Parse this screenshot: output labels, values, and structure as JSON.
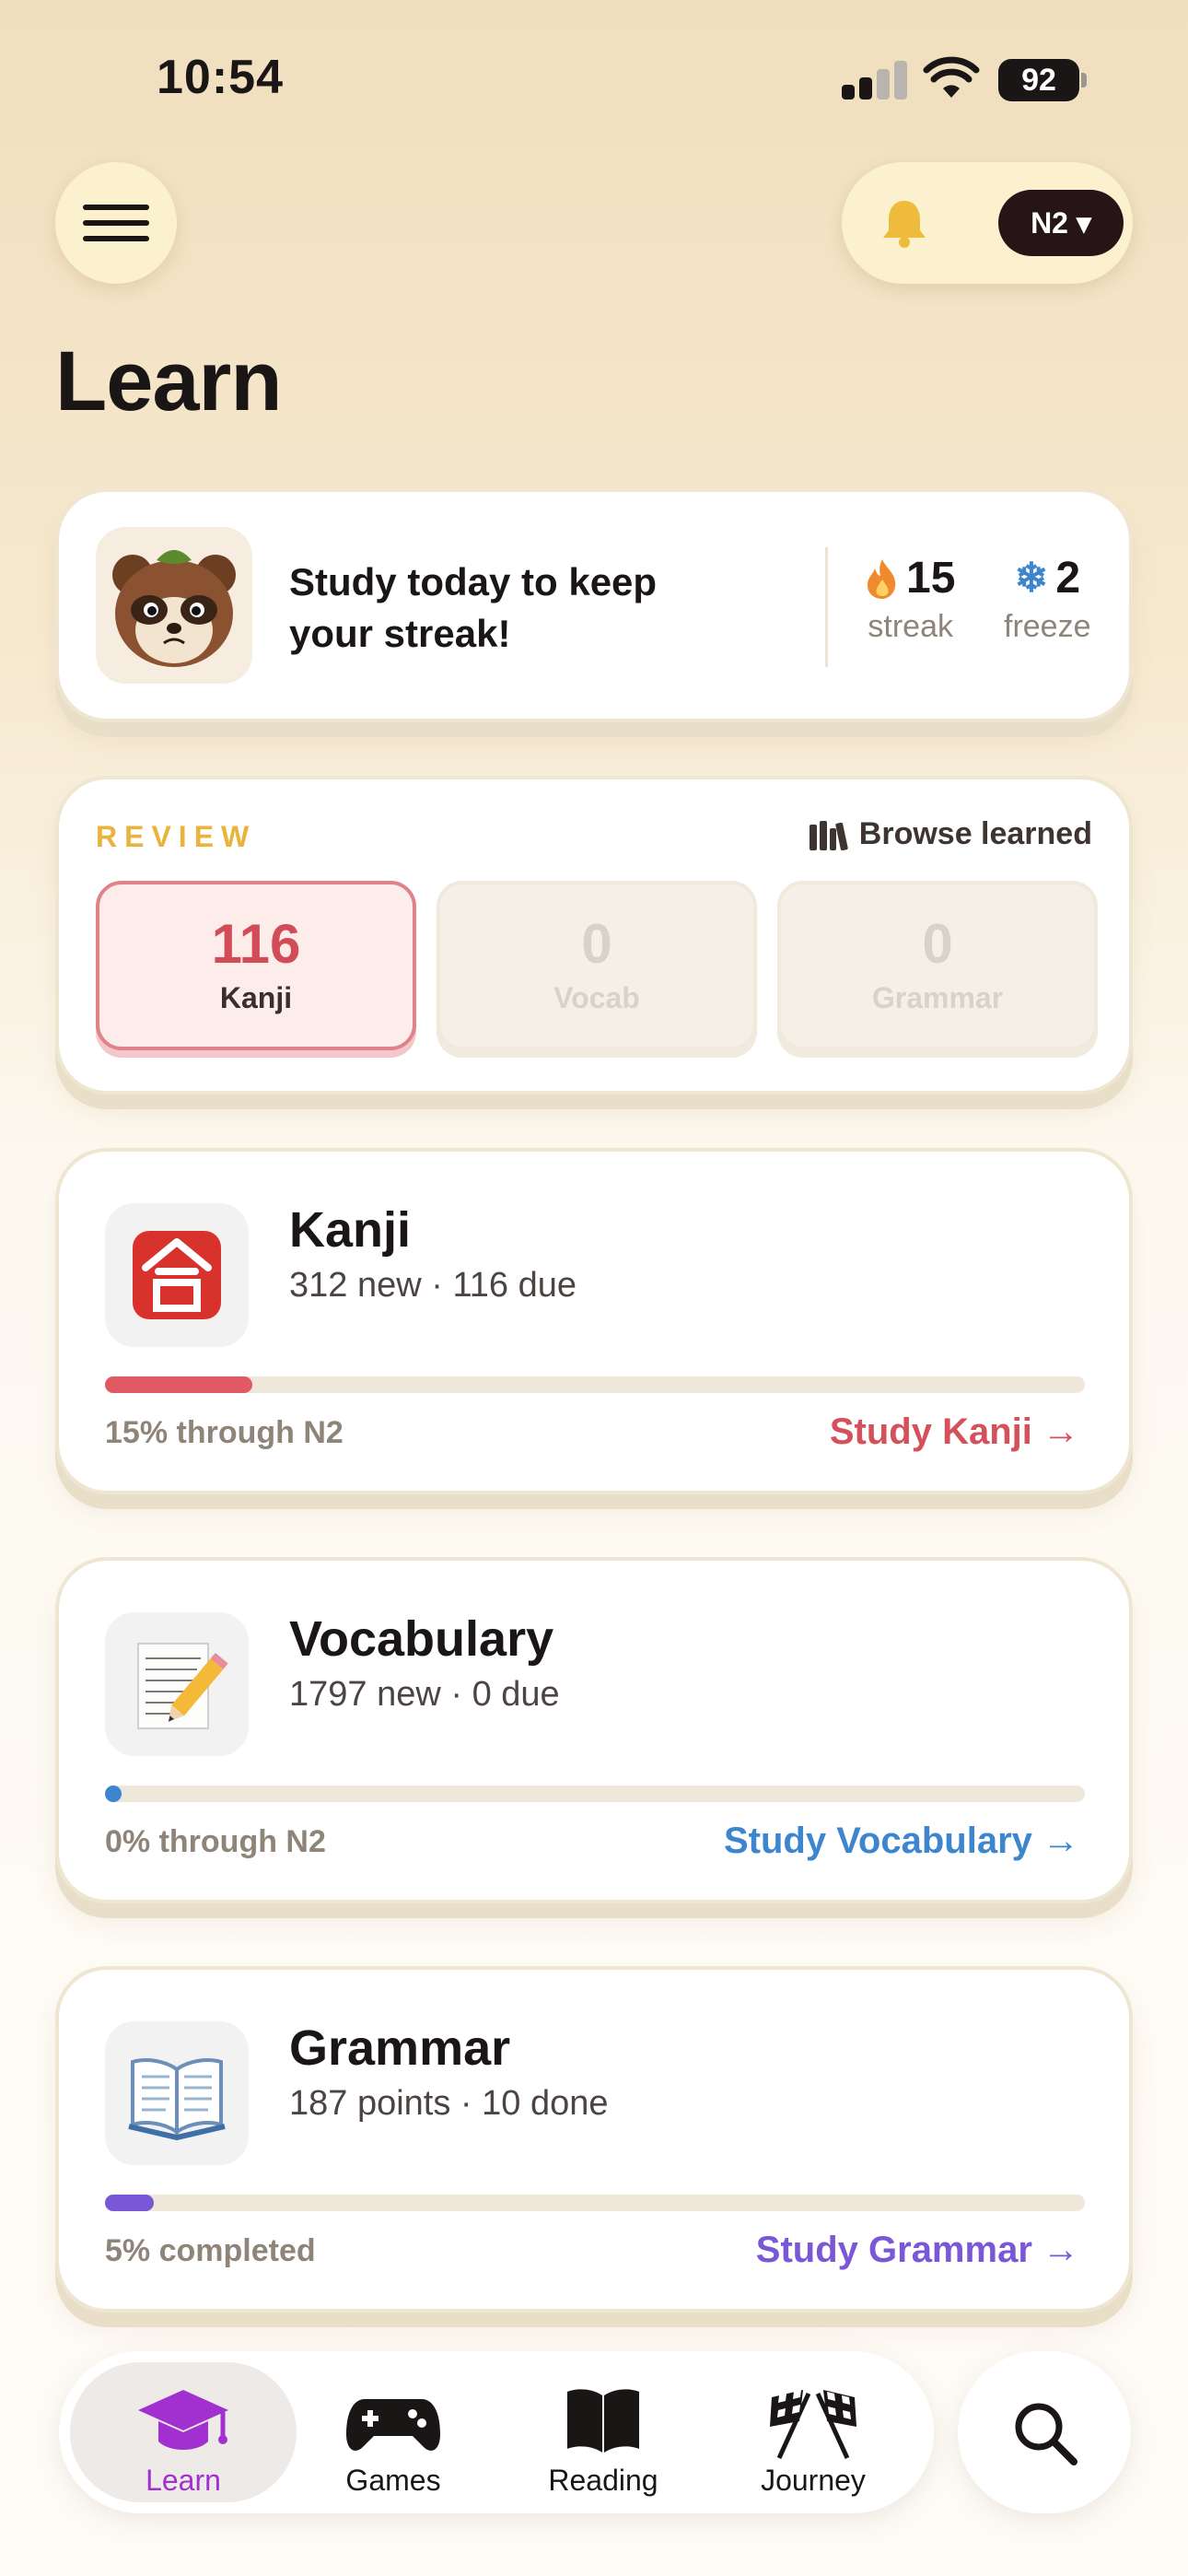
{
  "status_bar": {
    "time": "10:54",
    "battery": "92"
  },
  "header": {
    "level": "N2 ▾"
  },
  "page_title": "Learn",
  "streak": {
    "message": "Study today to keep your streak!",
    "streak_value": "15",
    "streak_label": "streak",
    "freeze_value": "2",
    "freeze_label": "freeze"
  },
  "review": {
    "title": "REVIEW",
    "browse_label": "Browse learned",
    "tiles": [
      {
        "count": "116",
        "label": "Kanji"
      },
      {
        "count": "0",
        "label": "Vocab"
      },
      {
        "count": "0",
        "label": "Grammar"
      }
    ]
  },
  "decks": [
    {
      "title": "Kanji",
      "subtitle": "312 new · 116 due",
      "progress": 0.15,
      "progress_text": "15% through N2",
      "action": "Study Kanji →",
      "icon": "kanji-gou-icon",
      "color": "#e05a63"
    },
    {
      "title": "Vocabulary",
      "subtitle": "1797 new · 0 due",
      "progress": 0.0,
      "progress_text": "0% through N2",
      "action": "Study Vocabulary →",
      "icon": "memo-pencil-icon",
      "color": "#3d86cf"
    },
    {
      "title": "Grammar",
      "subtitle": "187 points · 10 done",
      "progress": 0.05,
      "progress_text": "5% completed",
      "action": "Study Grammar →",
      "icon": "open-book-icon",
      "color": "#7a57d6"
    }
  ],
  "nav": {
    "items": [
      {
        "label": "Learn",
        "icon": "graduation-cap-icon"
      },
      {
        "label": "Games",
        "icon": "gamepad-icon"
      },
      {
        "label": "Reading",
        "icon": "book-icon"
      },
      {
        "label": "Journey",
        "icon": "checkered-flags-icon"
      }
    ],
    "search_icon": "search-icon"
  }
}
